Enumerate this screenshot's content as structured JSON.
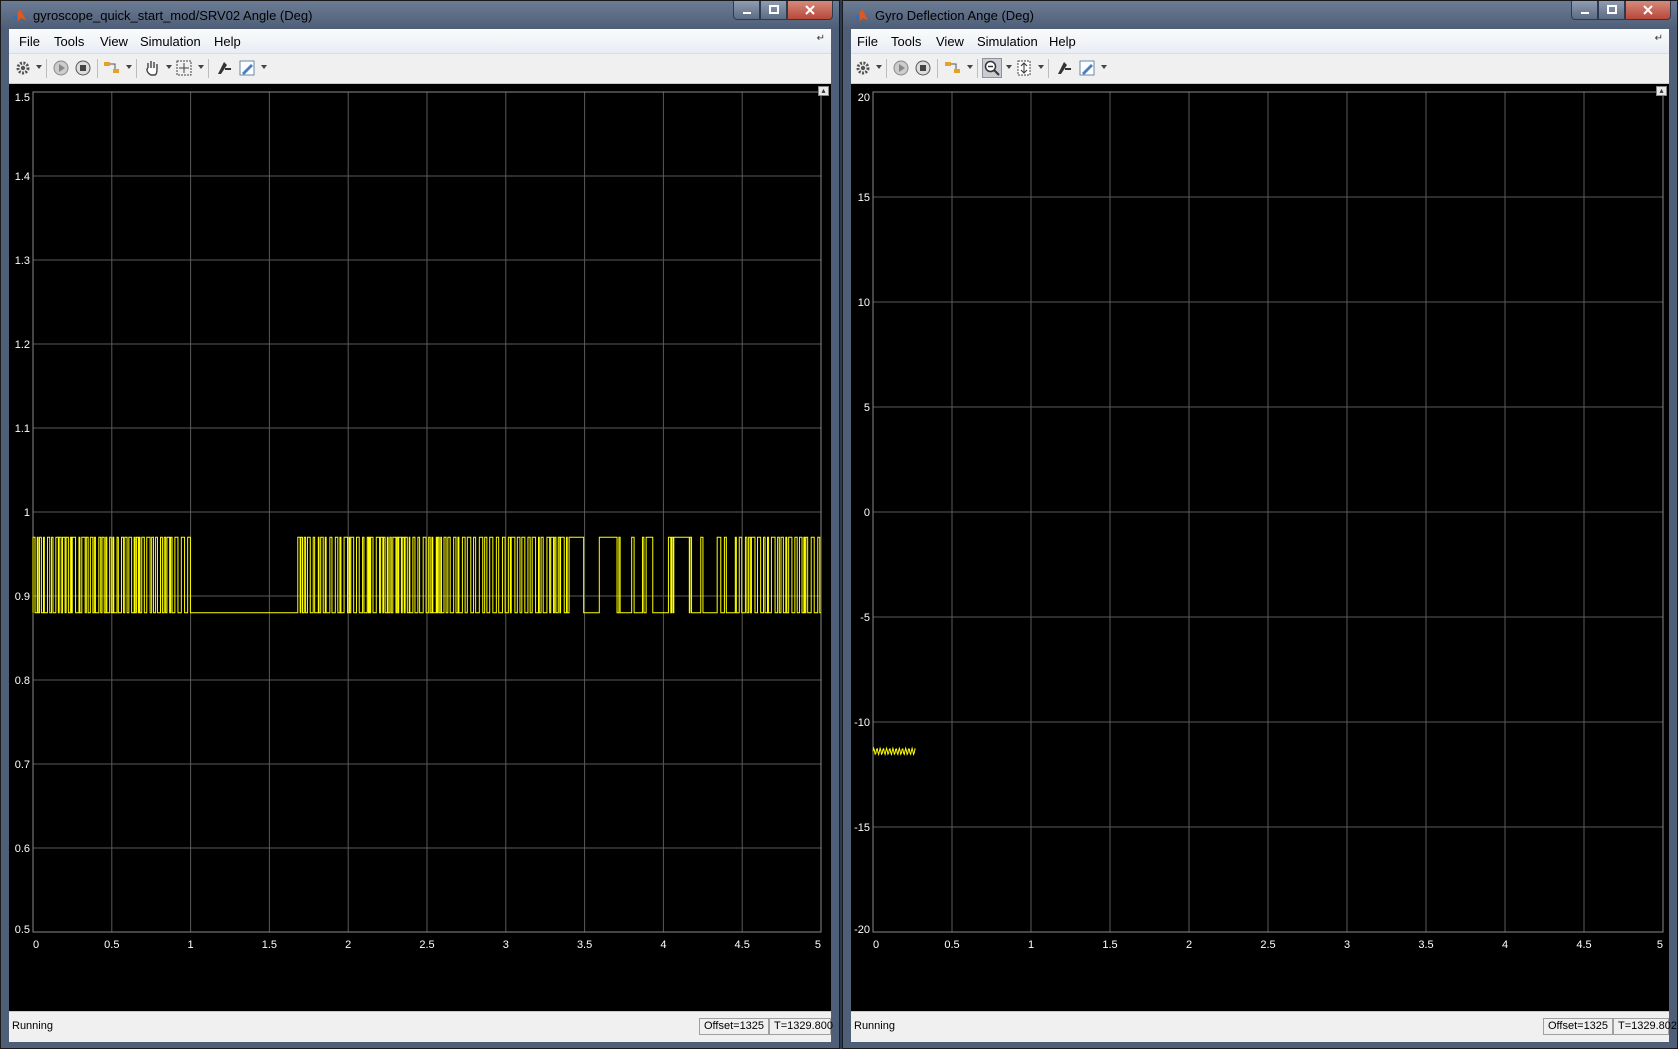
{
  "scope1": {
    "title": "gyroscope_quick_start_mod/SRV02  Angle (Deg)",
    "menu": [
      "File",
      "Tools",
      "View",
      "Simulation",
      "Help"
    ],
    "status": "Running",
    "offset": "Offset=1325",
    "time": "T=1329.800"
  },
  "scope2": {
    "title": "Gyro Deflection Ange (Deg)",
    "menu": [
      "File",
      "Tools",
      "View",
      "Simulation",
      "Help"
    ],
    "status": "Running",
    "offset": "Offset=1325",
    "time": "T=1329.802"
  },
  "colors": {
    "trace": "#ffff00",
    "plot_bg": "#000000",
    "grid": "#5a5a5a",
    "tick_text": "#ffffff"
  },
  "icons": [
    "settings-icon",
    "run-icon",
    "stop-icon",
    "highlight-icon",
    "pan-icon",
    "zoom-icon",
    "autoscale-icon",
    "measure-icon",
    "edit-icon"
  ],
  "chart_data": [
    {
      "type": "line",
      "xlim": [
        0,
        5
      ],
      "ylim": [
        0.5,
        1.5
      ],
      "x_ticks": [
        "0",
        "0.5",
        "1",
        "1.5",
        "2",
        "2.5",
        "3",
        "3.5",
        "4",
        "4.5",
        "5"
      ],
      "y_ticks": [
        "0.5",
        "0.6",
        "0.7",
        "0.8",
        "0.9",
        "1",
        "1.1",
        "1.2",
        "1.3",
        "1.4",
        "1.5"
      ],
      "grid": true,
      "signal": "square wave switching between 0.88 and 0.97",
      "low": 0.88,
      "high": 0.97,
      "dense_segments": [
        [
          0,
          1.0
        ],
        [
          1.68,
          5
        ]
      ],
      "flat_segment": [
        1.0,
        1.68
      ]
    },
    {
      "type": "line",
      "xlim": [
        0,
        5
      ],
      "ylim": [
        -20,
        20
      ],
      "x_ticks": [
        "0",
        "0.5",
        "1",
        "1.5",
        "2",
        "2.5",
        "3",
        "3.5",
        "4",
        "4.5",
        "5"
      ],
      "y_ticks": [
        "-20",
        "-15",
        "-10",
        "-5",
        "0",
        "5",
        "10",
        "15",
        "20"
      ],
      "grid": true,
      "series_x_range": [
        0,
        0.27
      ],
      "series_mean": -11.4,
      "ripple": 0.15
    }
  ]
}
